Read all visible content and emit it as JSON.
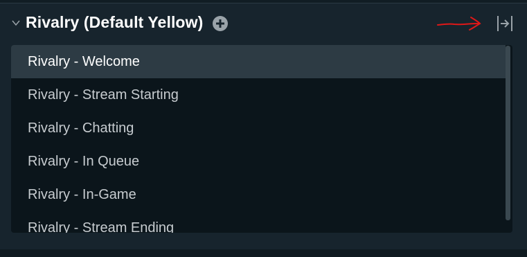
{
  "header": {
    "title": "Rivalry (Default Yellow)",
    "chevron_icon": "chevron-down-icon",
    "add_icon": "plus-circle-icon",
    "collapse_icon": "collapse-right-icon"
  },
  "annotation": {
    "icon": "red-hand-drawn-arrow",
    "color": "#e01818"
  },
  "scenes": [
    {
      "label": "Rivalry - Welcome",
      "selected": true
    },
    {
      "label": "Rivalry - Stream Starting",
      "selected": false
    },
    {
      "label": "Rivalry - Chatting",
      "selected": false
    },
    {
      "label": "Rivalry - In Queue",
      "selected": false
    },
    {
      "label": "Rivalry - In-Game",
      "selected": false
    },
    {
      "label": "Rivalry - Stream Ending",
      "selected": false
    }
  ],
  "colors": {
    "background": "#17242d",
    "list_background": "#0b151b",
    "selected_row": "#2d3b44",
    "title_text": "#ffffff",
    "item_text": "#c7ccd0",
    "icon_gray": "#9aa3a9"
  }
}
